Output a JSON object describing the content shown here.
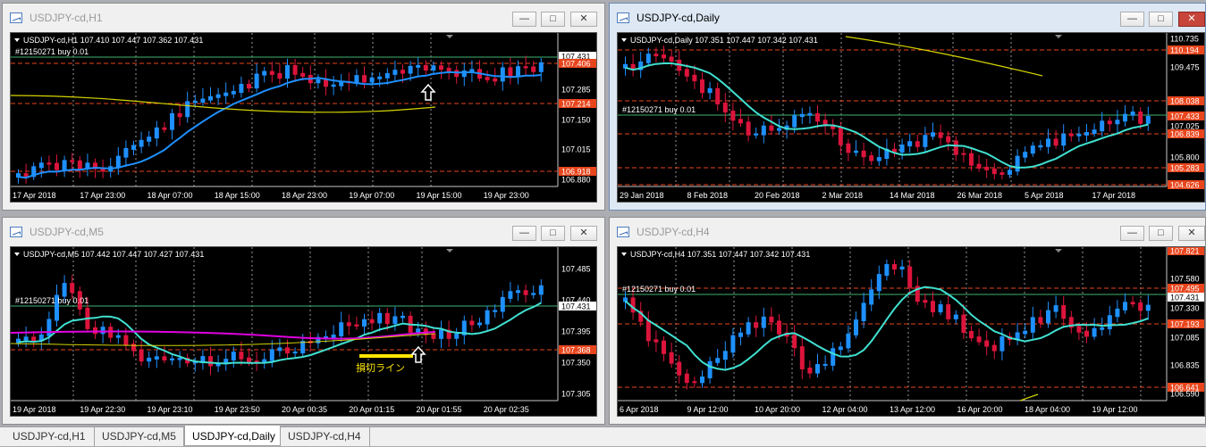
{
  "windows": [
    {
      "id": "w_h1",
      "active": false,
      "title": "USDJPY-cd,H1",
      "header": "USDJPY-cd,H1  107.410 107.447 107.362 107.431",
      "order": "#12150271 buy 0.01",
      "prices": [
        "107.431",
        "107.406",
        "107.285",
        "107.214",
        "107.150",
        "107.015",
        "106.918",
        "106.880"
      ],
      "price_highlight": {
        "107.406": "#e8451c",
        "107.214": "#e8451c",
        "106.918": "#e8451c",
        "107.431": "#ffffff"
      },
      "times": [
        "17 Apr 2018",
        "17 Apr 23:00",
        "18 Apr 07:00",
        "18 Apr 15:00",
        "18 Apr 23:00",
        "19 Apr 07:00",
        "19 Apr 15:00",
        "19 Apr 23:00"
      ]
    },
    {
      "id": "w_d1",
      "active": true,
      "title": "USDJPY-cd,Daily",
      "header": "USDJPY-cd,Daily  107.351 107.447 107.342 107.431",
      "order": "#12150271 buy 0.01",
      "prices": [
        "110.735",
        "110.194",
        "109.475",
        "108.038",
        "107.433",
        "107.025",
        "106.839",
        "105.800",
        "105.283",
        "104.626"
      ],
      "price_highlight": {
        "110.194": "#e8451c",
        "108.038": "#e8451c",
        "107.433": "#e8451c",
        "106.839": "#e8451c",
        "105.283": "#e8451c",
        "104.626": "#e8451c"
      },
      "times": [
        "29 Jan 2018",
        "8 Feb 2018",
        "20 Feb 2018",
        "2 Mar 2018",
        "14 Mar 2018",
        "26 Mar 2018",
        "5 Apr 2018",
        "17 Apr 2018"
      ]
    },
    {
      "id": "w_m5",
      "active": false,
      "title": "USDJPY-cd,M5",
      "header": "USDJPY-cd,M5  107.442 107.447 107.427 107.431",
      "order": "#12150271 buy 0.01",
      "annotation": "損切ライン",
      "prices": [
        "107.485",
        "107.440",
        "107.431",
        "107.395",
        "107.368",
        "107.350",
        "107.305"
      ],
      "price_highlight": {
        "107.431": "#ffffff",
        "107.368": "#e8451c"
      },
      "times": [
        "19 Apr 2018",
        "19 Apr 22:30",
        "19 Apr 23:10",
        "19 Apr 23:50",
        "20 Apr 00:35",
        "20 Apr 01:15",
        "20 Apr 01:55",
        "20 Apr 02:35"
      ]
    },
    {
      "id": "w_h4",
      "active": false,
      "title": "USDJPY-cd,H4",
      "header": "USDJPY-cd,H4  107.351 107.447 107.342 107.431",
      "order": "#12150271 buy 0.01",
      "prices": [
        "107.821",
        "107.580",
        "107.495",
        "107.431",
        "107.330",
        "107.193",
        "107.085",
        "106.835",
        "106.641",
        "106.590"
      ],
      "price_highlight": {
        "107.821": "#e8451c",
        "107.495": "#e8451c",
        "107.431": "#ffffff",
        "107.193": "#e8451c",
        "106.641": "#e8451c"
      },
      "times": [
        "6 Apr 2018",
        "9 Apr 12:00",
        "10 Apr 20:00",
        "12 Apr 04:00",
        "13 Apr 12:00",
        "16 Apr 20:00",
        "18 Apr 04:00",
        "19 Apr 12:00"
      ]
    }
  ],
  "tabs": [
    "USDJPY-cd,H1",
    "USDJPY-cd,M5",
    "USDJPY-cd,Daily",
    "USDJPY-cd,H4"
  ],
  "active_tab": "USDJPY-cd,Daily",
  "colors": {
    "bull": "#1e90ff",
    "bear": "#dc143c",
    "ma_fast": "#40e0d0",
    "ma_fast_h1": "#1e90ff",
    "ma_slow": "#d4d400",
    "ma_m5": "#e000e0",
    "level": "#e8451c",
    "order_line": "#3cb371",
    "stop_line": "#ffe600"
  }
}
